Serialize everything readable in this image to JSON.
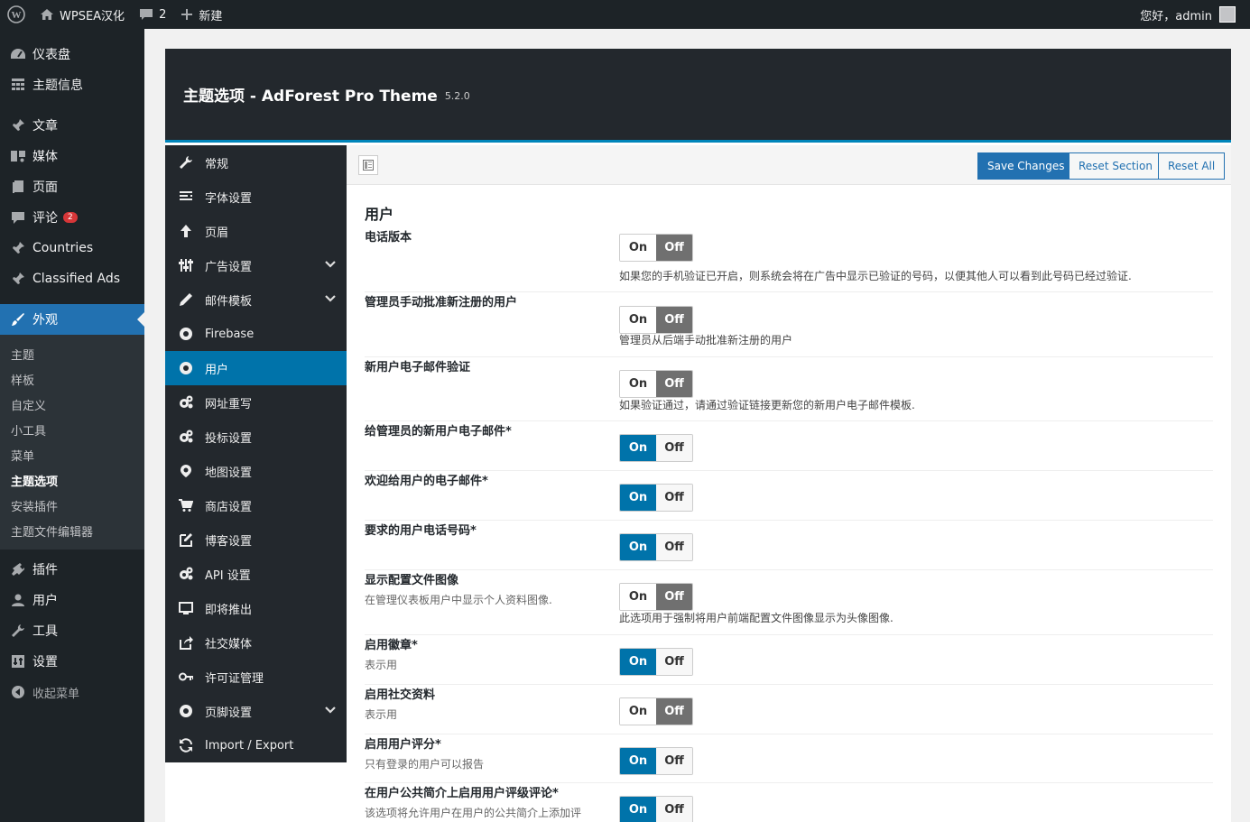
{
  "adminbar": {
    "site_name": "WPSEA汉化",
    "comments_count": "2",
    "new_label": "新建",
    "greeting": "您好，admin"
  },
  "sidebar": {
    "items": [
      {
        "label": "仪表盘",
        "icon": "dashboard-icon"
      },
      {
        "label": "主题信息",
        "icon": "grid-icon"
      },
      {
        "label": "文章",
        "icon": "pin-icon"
      },
      {
        "label": "媒体",
        "icon": "media-icon"
      },
      {
        "label": "页面",
        "icon": "page-icon"
      },
      {
        "label": "评论",
        "icon": "comment-icon",
        "badge": "2"
      },
      {
        "label": "Countries",
        "icon": "pin-icon"
      },
      {
        "label": "Classified Ads",
        "icon": "pin-icon"
      },
      {
        "label": "外观",
        "icon": "brush-icon"
      }
    ],
    "appearance_sub": [
      "主题",
      "样板",
      "自定义",
      "小工具",
      "菜单",
      "主题选项",
      "安装插件",
      "主题文件编辑器"
    ],
    "lower_items": [
      {
        "label": "插件",
        "icon": "plugin-icon"
      },
      {
        "label": "用户",
        "icon": "user-icon"
      },
      {
        "label": "工具",
        "icon": "wrench-icon"
      },
      {
        "label": "设置",
        "icon": "settings-icon"
      },
      {
        "label": "收起菜单",
        "icon": "collapse-icon"
      }
    ]
  },
  "panel": {
    "title": "主题选项 - AdForest Pro Theme",
    "version": "5.2.0"
  },
  "toolbar": {
    "save": "Save Changes",
    "reset_section": "Reset Section",
    "reset_all": "Reset All"
  },
  "nav": [
    {
      "label": "常规",
      "icon": "wrench-icon"
    },
    {
      "label": "字体设置",
      "icon": "text-icon"
    },
    {
      "label": "页眉",
      "icon": "arrow-up-icon"
    },
    {
      "label": "广告设置",
      "icon": "sliders-icon",
      "chevron": true
    },
    {
      "label": "邮件模板",
      "icon": "pencil-icon",
      "chevron": true
    },
    {
      "label": "Firebase",
      "icon": "gear-icon"
    },
    {
      "label": "用户",
      "icon": "gear-icon"
    },
    {
      "label": "网址重写",
      "icon": "gears-icon"
    },
    {
      "label": "投标设置",
      "icon": "gears-icon"
    },
    {
      "label": "地图设置",
      "icon": "map-marker-icon"
    },
    {
      "label": "商店设置",
      "icon": "cart-icon"
    },
    {
      "label": "博客设置",
      "icon": "edit-icon"
    },
    {
      "label": "API 设置",
      "icon": "gears-icon"
    },
    {
      "label": "即将推出",
      "icon": "monitor-icon"
    },
    {
      "label": "社交媒体",
      "icon": "share-icon"
    },
    {
      "label": "许可证管理",
      "icon": "key-icon"
    },
    {
      "label": "页脚设置",
      "icon": "gear-icon",
      "chevron": true
    },
    {
      "label": "Import / Export",
      "icon": "refresh-icon"
    }
  ],
  "section_title": "用户",
  "switch_labels": {
    "on": "On",
    "off": "Off"
  },
  "fields": [
    {
      "label": "电话版本",
      "subtitle": "",
      "state": "off",
      "desc": "如果您的手机验证已开启，则系统会将在广告中显示已验证的号码，以便其他人可以看到此号码已经过验证."
    },
    {
      "label": "管理员手动批准新注册的用户",
      "subtitle": "",
      "state": "off",
      "desc": "管理员从后端手动批准新注册的用户"
    },
    {
      "label": "新用户电子邮件验证",
      "subtitle": "",
      "state": "off",
      "desc": "如果验证通过，请通过验证链接更新您的新用户电子邮件模板."
    },
    {
      "label": "给管理员的新用户电子邮件*",
      "subtitle": "",
      "state": "on",
      "desc": ""
    },
    {
      "label": "欢迎给用户的电子邮件*",
      "subtitle": "",
      "state": "on",
      "desc": ""
    },
    {
      "label": "要求的用户电话号码*",
      "subtitle": "",
      "state": "on",
      "desc": ""
    },
    {
      "label": "显示配置文件图像",
      "subtitle": "在管理仪表板用户中显示个人资料图像.",
      "state": "off",
      "desc": "此选项用于强制将用户前端配置文件图像显示为头像图像."
    },
    {
      "label": "启用徽章*",
      "subtitle": "表示用",
      "state": "on",
      "desc": ""
    },
    {
      "label": "启用社交资料",
      "subtitle": "表示用",
      "state": "off",
      "desc": ""
    },
    {
      "label": "启用用户评分*",
      "subtitle": "只有登录的用户可以报告",
      "state": "on",
      "desc": ""
    },
    {
      "label": "在用户公共简介上启用用户评级评论*",
      "subtitle": "该选项将允许用户在用户的公共简介上添加评",
      "state": "on",
      "desc": ""
    }
  ]
}
